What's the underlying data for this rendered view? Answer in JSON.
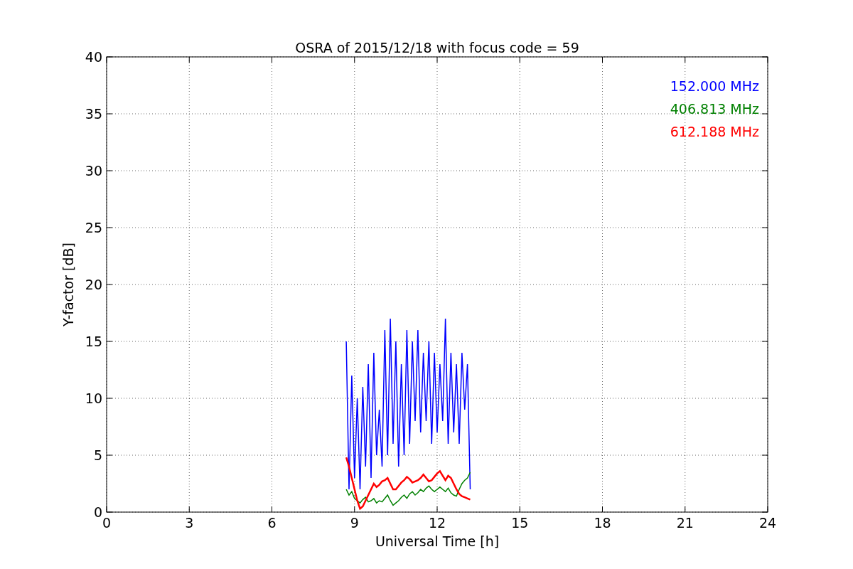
{
  "chart": {
    "chart_data": {
      "type": "line",
      "title": "OSRA of 2015/12/18 with focus code = 59",
      "xlabel": "Universal Time [h]",
      "ylabel": "Y-factor [dB]",
      "x": [
        8.7,
        8.8,
        8.9,
        9.0,
        9.1,
        9.2,
        9.3,
        9.4,
        9.5,
        9.6,
        9.7,
        9.8,
        9.9,
        10.0,
        10.1,
        10.2,
        10.3,
        10.4,
        10.5,
        10.6,
        10.7,
        10.8,
        10.9,
        11.0,
        11.1,
        11.2,
        11.3,
        11.4,
        11.5,
        11.6,
        11.7,
        11.8,
        11.9,
        12.0,
        12.1,
        12.2,
        12.3,
        12.4,
        12.5,
        12.6,
        12.7,
        12.8,
        12.9,
        13.0,
        13.1,
        13.2
      ],
      "series": [
        {
          "name": "152.000 MHz",
          "color": "#0000ff",
          "values": [
            15,
            2,
            12,
            3,
            10,
            2,
            11,
            4,
            13,
            3,
            14,
            5,
            9,
            4,
            16,
            5,
            17,
            6,
            15,
            4,
            13,
            5,
            16,
            6,
            15,
            8,
            16,
            7,
            14,
            8,
            15,
            6,
            14,
            7,
            13,
            8,
            17,
            6,
            14,
            7,
            13,
            6,
            14,
            9,
            13,
            2
          ]
        },
        {
          "name": "406.813 MHz",
          "color": "#008000",
          "values": [
            2,
            1.5,
            1.8,
            1.2,
            1,
            0.8,
            1.1,
            1.3,
            0.9,
            1,
            1.2,
            0.8,
            1,
            0.9,
            1.2,
            1.5,
            1,
            0.6,
            0.8,
            1,
            1.3,
            1.5,
            1.2,
            1.6,
            1.8,
            1.5,
            1.7,
            2,
            1.8,
            2.1,
            2.3,
            2,
            1.8,
            2,
            2.2,
            2,
            1.8,
            2.1,
            1.7,
            1.5,
            1.4,
            2,
            2.5,
            2.8,
            3,
            3.5
          ]
        },
        {
          "name": "612.188 MHz",
          "color": "#ff0000",
          "values": [
            4.8,
            4,
            3,
            2,
            1,
            0.3,
            0.5,
            1,
            1.5,
            2,
            2.5,
            2.2,
            2.4,
            2.7,
            2.8,
            3,
            2.5,
            2,
            2,
            2.3,
            2.6,
            2.8,
            3.1,
            2.9,
            2.6,
            2.7,
            2.8,
            3,
            3.3,
            3,
            2.7,
            2.8,
            3.1,
            3.4,
            3.6,
            3.2,
            2.8,
            3.2,
            3,
            2.5,
            2,
            1.6,
            1.4,
            1.3,
            1.2,
            1.1
          ]
        }
      ],
      "xlim": [
        0,
        24
      ],
      "ylim": [
        0,
        40
      ],
      "xticks": [
        0,
        3,
        6,
        9,
        12,
        15,
        18,
        21,
        24
      ],
      "yticks": [
        0,
        5,
        10,
        15,
        20,
        25,
        30,
        35,
        40
      ],
      "grid": true
    }
  }
}
